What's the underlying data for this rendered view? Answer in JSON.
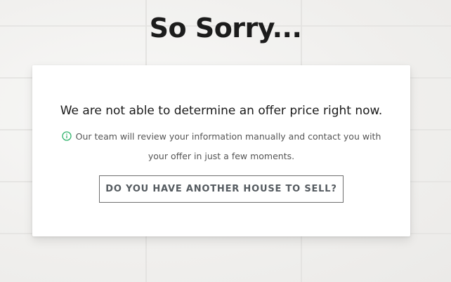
{
  "page": {
    "title": "So Sorry..."
  },
  "card": {
    "headline": "We are not able to determine an offer price right now.",
    "note": "Our team will review your information manually and contact you with your offer in just a few moments.",
    "info_icon": "info-circle-icon",
    "info_icon_color": "#2fb36b",
    "cta_label": "DO YOU HAVE ANOTHER HOUSE TO SELL?"
  }
}
